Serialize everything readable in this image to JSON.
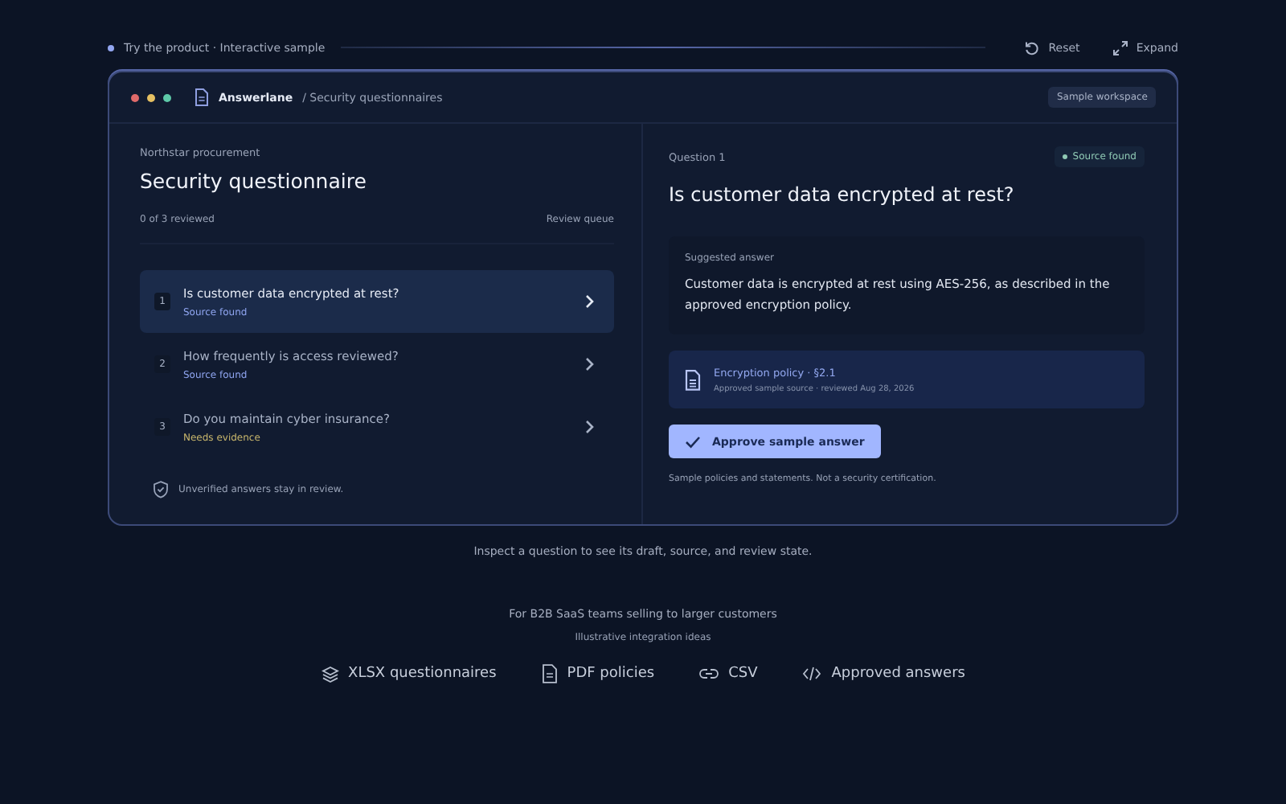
{
  "top_bar": {
    "label": "Try the product · Interactive sample",
    "actions": [
      {
        "kind": "reset",
        "label": "Reset"
      },
      {
        "kind": "expand",
        "label": "Expand"
      }
    ]
  },
  "window": {
    "app_name": "Answerlane",
    "breadcrumb": "/ Security questionnaires",
    "badge": "Sample workspace"
  },
  "left": {
    "eyebrow": "Northstar procurement",
    "title": "Security questionnaire",
    "progress": "0 of 3 reviewed",
    "queue_label": "Review queue",
    "questions": [
      {
        "number": "1",
        "text": "Is customer data encrypted at rest?",
        "status": "Source found",
        "needs_evidence": false,
        "selected": true
      },
      {
        "number": "2",
        "text": "How frequently is access reviewed?",
        "status": "Source found",
        "needs_evidence": false,
        "selected": false
      },
      {
        "number": "3",
        "text": "Do you maintain cyber insurance?",
        "status": "Needs evidence",
        "needs_evidence": true,
        "selected": false
      }
    ],
    "footnote": "Unverified answers stay in review."
  },
  "right": {
    "eyebrow": "Question 1",
    "status_badge": "Source found",
    "title": "Is customer data encrypted at rest?",
    "answer_label": "Suggested answer",
    "answer": "Customer data is encrypted at rest using AES-256, as described in the approved encryption policy.",
    "source_title": "Encryption policy · §2.1",
    "source_meta": "Approved sample source · reviewed Aug 28, 2026",
    "approve_button": "Approve sample answer",
    "disclaimer": "Sample policies and statements. Not a security certification."
  },
  "caption": "Inspect a question to see its draft, source, and review state.",
  "audience": "For B2B SaaS teams selling to larger customers",
  "integrations_label": "Illustrative integration ideas",
  "integrations": [
    {
      "kind": "layers",
      "label": "XLSX questionnaires"
    },
    {
      "kind": "file",
      "label": "PDF policies"
    },
    {
      "kind": "link",
      "label": "CSV"
    },
    {
      "kind": "code",
      "label": "Approved answers"
    }
  ]
}
